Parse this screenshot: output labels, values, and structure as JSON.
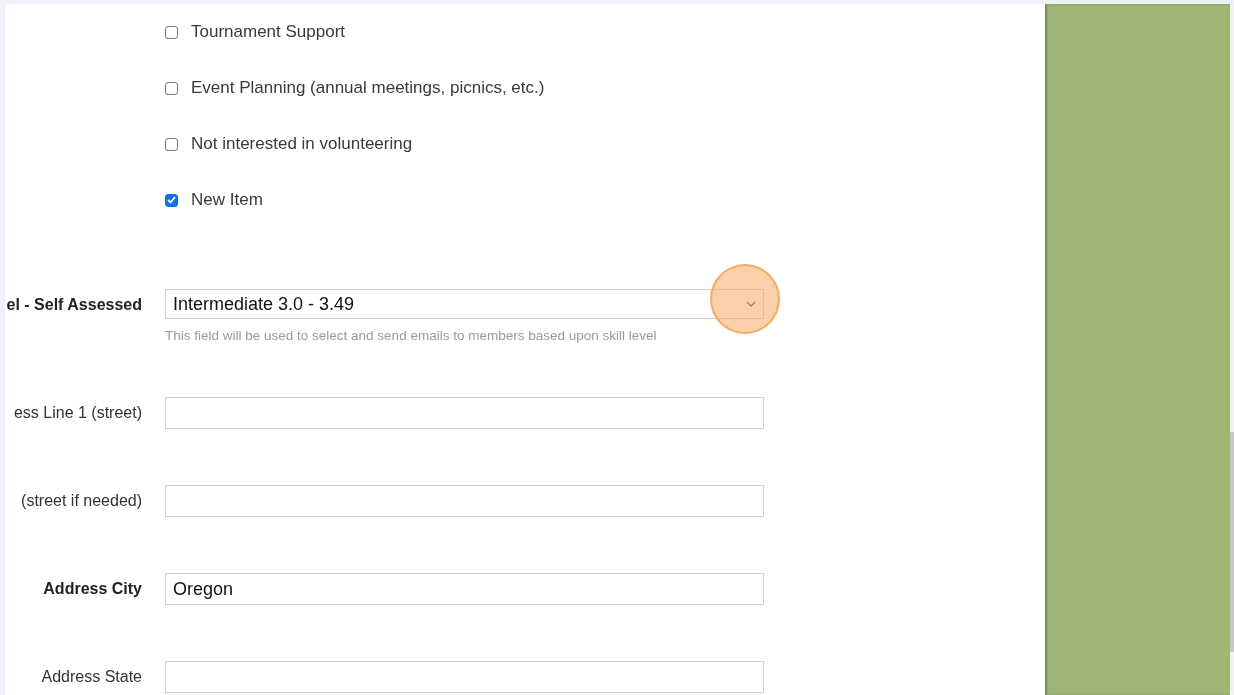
{
  "options": [
    {
      "label": "Tournament Support",
      "checked": false
    },
    {
      "label": "Event Planning (annual meetings, picnics, etc.)",
      "checked": false
    },
    {
      "label": "Not interested in volunteering",
      "checked": false
    },
    {
      "label": "New Item",
      "checked": true
    }
  ],
  "fields": [
    {
      "kind": "select",
      "label": "el - Self Assessed",
      "emphasized": true,
      "value": "Intermediate 3.0 - 3.49",
      "help": "This field will be used to select and send emails to members based upon skill level"
    },
    {
      "kind": "text",
      "label": "ess Line 1 (street)",
      "emphasized": false
    },
    {
      "kind": "text",
      "label": "(street if needed)",
      "emphasized": false
    },
    {
      "kind": "text",
      "label": "Address City",
      "emphasized": true,
      "value": "Oregon"
    },
    {
      "kind": "text",
      "label": "Address State",
      "emphasized": false
    }
  ]
}
